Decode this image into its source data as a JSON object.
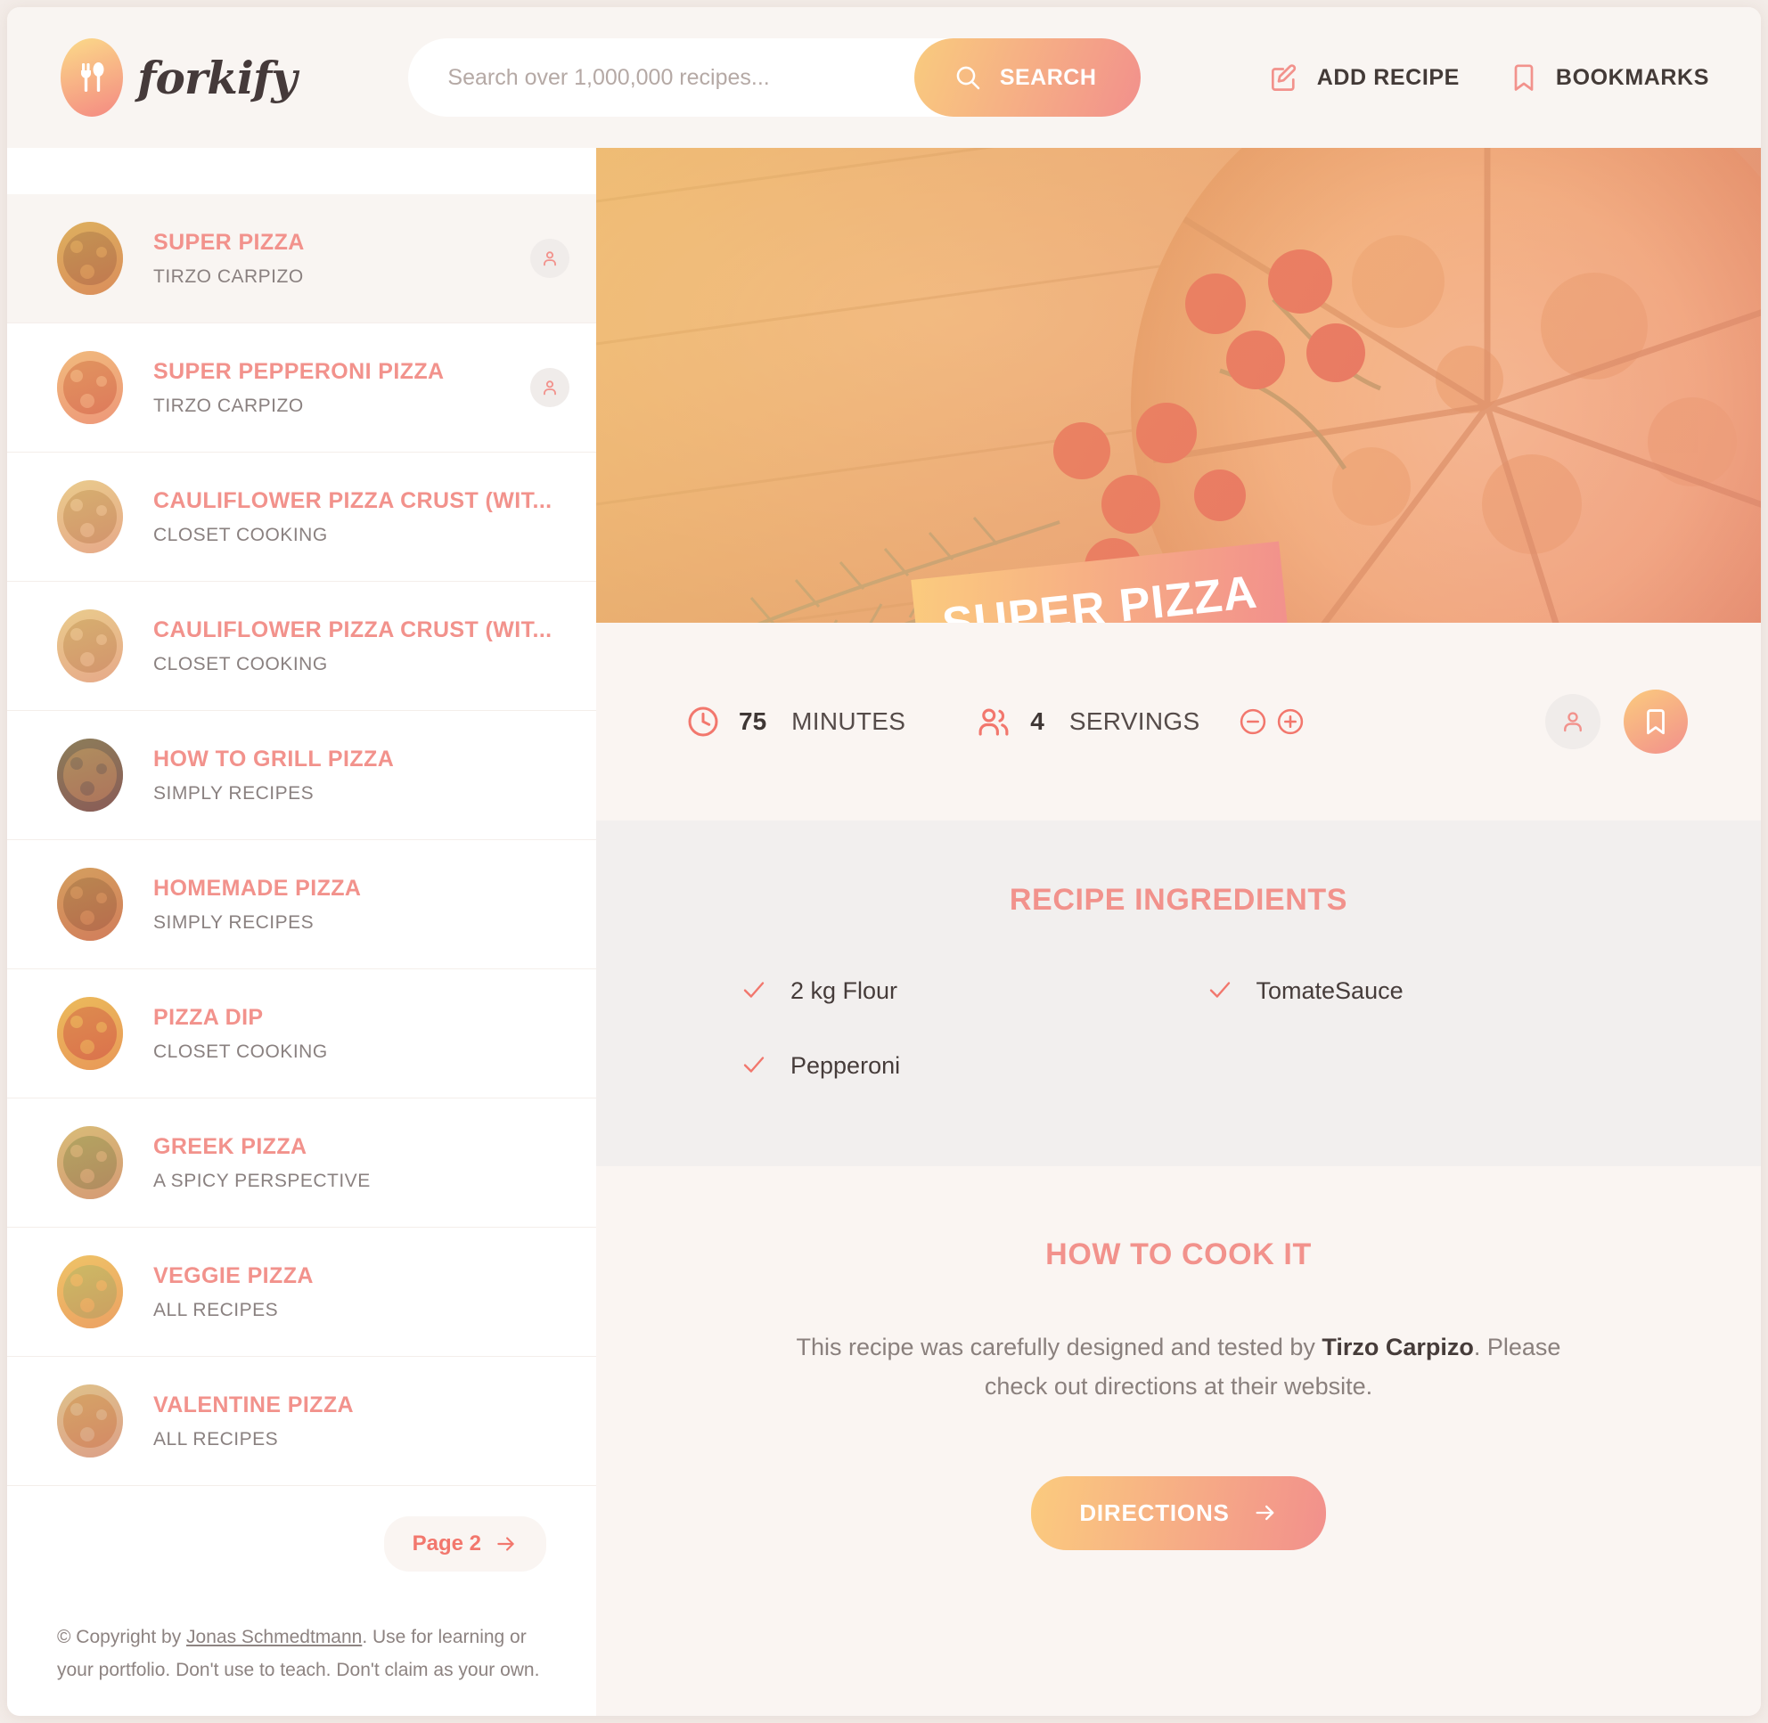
{
  "brand": {
    "name": "forkify",
    "logo_icon": "fork-spoon-icon"
  },
  "search": {
    "placeholder": "Search over 1,000,000 recipes...",
    "value": "",
    "button_label": "SEARCH",
    "button_icon": "search-icon"
  },
  "nav": {
    "add_recipe": {
      "label": "ADD RECIPE",
      "icon": "edit-square-icon"
    },
    "bookmarks": {
      "label": "BOOKMARKS",
      "icon": "bookmark-icon"
    }
  },
  "sidebar": {
    "results": [
      {
        "title": "SUPER PIZZA",
        "publisher": "TIRZO CARPIZO",
        "has_user_badge": true,
        "active": true
      },
      {
        "title": "SUPER PEPPERONI PIZZA",
        "publisher": "TIRZO CARPIZO",
        "has_user_badge": true,
        "active": false
      },
      {
        "title": "CAULIFLOWER PIZZA CRUST (WIT...",
        "publisher": "CLOSET COOKING",
        "has_user_badge": false,
        "active": false
      },
      {
        "title": "CAULIFLOWER PIZZA CRUST (WIT...",
        "publisher": "CLOSET COOKING",
        "has_user_badge": false,
        "active": false
      },
      {
        "title": "HOW TO GRILL PIZZA",
        "publisher": "SIMPLY RECIPES",
        "has_user_badge": false,
        "active": false
      },
      {
        "title": "HOMEMADE PIZZA",
        "publisher": "SIMPLY RECIPES",
        "has_user_badge": false,
        "active": false
      },
      {
        "title": "PIZZA DIP",
        "publisher": "CLOSET COOKING",
        "has_user_badge": false,
        "active": false
      },
      {
        "title": "GREEK PIZZA",
        "publisher": "A SPICY PERSPECTIVE",
        "has_user_badge": false,
        "active": false
      },
      {
        "title": "VEGGIE PIZZA",
        "publisher": "ALL RECIPES",
        "has_user_badge": false,
        "active": false
      },
      {
        "title": "VALENTINE PIZZA",
        "publisher": "ALL RECIPES",
        "has_user_badge": false,
        "active": false
      }
    ],
    "pagination": {
      "next_label": "Page 2",
      "next_icon": "arrow-right-icon"
    },
    "copyright": {
      "prefix": "© Copyright by ",
      "author": "Jonas Schmedtmann",
      "suffix": ". Use for learning or your portfolio. Don't use to teach. Don't claim as your own."
    }
  },
  "recipe": {
    "title": "SUPER PIZZA",
    "image_alt": "pizza-hero-photo",
    "time": {
      "value": "75",
      "unit": "MINUTES",
      "icon": "clock-icon"
    },
    "servings": {
      "value": "4",
      "unit": "SERVINGS",
      "icon": "users-icon",
      "decrease_icon": "minus-circle-icon",
      "increase_icon": "plus-circle-icon"
    },
    "user_generated_icon": "user-icon",
    "bookmark_icon": "bookmark-icon",
    "ingredients_title": "RECIPE INGREDIENTS",
    "ingredients": [
      {
        "text": "2 kg Flour",
        "icon": "check-icon"
      },
      {
        "text": "TomateSauce",
        "icon": "check-icon"
      },
      {
        "text": "Pepperoni",
        "icon": "check-icon"
      }
    ],
    "directions_title": "HOW TO COOK IT",
    "directions_prefix": "This recipe was carefully designed and tested by ",
    "directions_publisher": "Tirzo Carpizo",
    "directions_suffix": ". Please check out directions at their website.",
    "directions_button": {
      "label": "DIRECTIONS",
      "icon": "arrow-right-icon"
    }
  },
  "colors": {
    "grad_start": "#fbcb7e",
    "grad_end": "#f2908c",
    "primary": "#f2776d",
    "text_dark": "#463c3a",
    "text_light": "#8a807d",
    "bg": "#faf5f2",
    "bg_alt": "#f2efee"
  }
}
